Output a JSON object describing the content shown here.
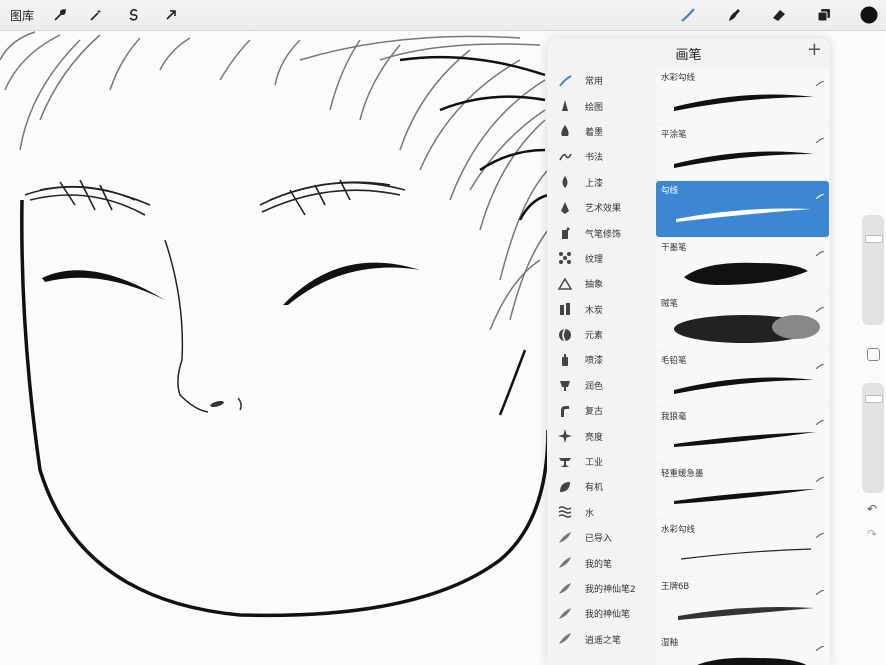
{
  "toolbar": {
    "gallery_label": "图库",
    "left_tools": [
      "wrench-icon",
      "magic-wand-icon",
      "selection-s-icon",
      "transform-arrow-icon"
    ],
    "right_tools": [
      "brush-icon",
      "smudge-icon",
      "eraser-icon",
      "layers-icon",
      "color-icon"
    ],
    "accent_color": "#3d86d2",
    "current_color": "#111111"
  },
  "panel": {
    "title": "画笔",
    "add_label": "+",
    "sets": [
      {
        "label": "常用",
        "icon": "recent-icon"
      },
      {
        "label": "绘图",
        "icon": "sketching-icon"
      },
      {
        "label": "着墨",
        "icon": "inking-icon"
      },
      {
        "label": "书法",
        "icon": "calligraphy-icon"
      },
      {
        "label": "上漆",
        "icon": "painting-icon"
      },
      {
        "label": "艺术效果",
        "icon": "artistic-icon"
      },
      {
        "label": "气笔修饰",
        "icon": "airbrush-icon"
      },
      {
        "label": "纹理",
        "icon": "texture-icon"
      },
      {
        "label": "抽象",
        "icon": "abstract-icon"
      },
      {
        "label": "木炭",
        "icon": "charcoal-icon"
      },
      {
        "label": "元素",
        "icon": "elements-icon"
      },
      {
        "label": "喷漆",
        "icon": "spraypaint-icon"
      },
      {
        "label": "润色",
        "icon": "touchup-icon"
      },
      {
        "label": "复古",
        "icon": "vintage-icon"
      },
      {
        "label": "亮度",
        "icon": "luminance-icon"
      },
      {
        "label": "工业",
        "icon": "industrial-icon"
      },
      {
        "label": "有机",
        "icon": "organic-icon"
      },
      {
        "label": "水",
        "icon": "water-icon"
      },
      {
        "label": "已导入",
        "icon": "imported-icon"
      },
      {
        "label": "我的笔",
        "icon": "feather-icon"
      },
      {
        "label": "我的神仙笔2",
        "icon": "feather-icon"
      },
      {
        "label": "我的神仙笔",
        "icon": "feather-icon"
      },
      {
        "label": "逍遥之笔",
        "icon": "feather-icon"
      }
    ],
    "brushes": [
      {
        "name": "水彩勾线",
        "style": "taper"
      },
      {
        "name": "平涂笔",
        "style": "taper"
      },
      {
        "name": "勾线",
        "style": "selected"
      },
      {
        "name": "干墨笔",
        "style": "rough"
      },
      {
        "name": "贼笔",
        "style": "cloud"
      },
      {
        "name": "毛铅笔",
        "style": "taper"
      },
      {
        "name": "我狼毫",
        "style": "thin"
      },
      {
        "name": "轻重缓急墨",
        "style": "thin"
      },
      {
        "name": "水彩勾线",
        "style": "hair"
      },
      {
        "name": "王牌6B",
        "style": "grainy"
      },
      {
        "name": "湿釉",
        "style": "rough"
      }
    ]
  },
  "sidebar": {
    "controls": [
      "brush-size-slider",
      "modify-button",
      "opacity-slider",
      "undo-icon",
      "redo-icon"
    ],
    "undo_icon": "↶",
    "redo_icon": "↷"
  }
}
